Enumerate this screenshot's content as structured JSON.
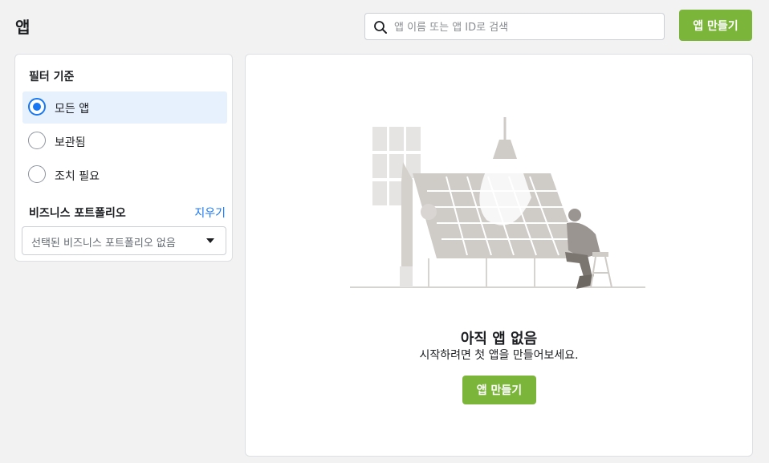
{
  "header": {
    "title": "앱",
    "search_placeholder": "앱 이름 또는 앱 ID로 검색",
    "search_icon": "search-icon",
    "create_button": "앱 만들기"
  },
  "sidebar": {
    "filter_heading": "필터 기준",
    "options": [
      {
        "label": "모든 앱",
        "selected": true
      },
      {
        "label": "보관됨",
        "selected": false
      },
      {
        "label": "조치 필요",
        "selected": false
      }
    ],
    "portfolio_heading": "비즈니스 포트폴리오",
    "clear_link": "지우기",
    "portfolio_select_value": "선택된 비즈니스 포트폴리오 없음",
    "select_icon": "caret-down-icon"
  },
  "main": {
    "illustration": "person-at-drafting-table-illustration",
    "empty_title": "아직 앱 없음",
    "empty_subtitle": "시작하려면 첫 앱을 만들어보세요.",
    "create_button": "앱 만들기"
  },
  "colors": {
    "accent_green": "#7bb53a",
    "selected_blue": "#1877f2",
    "selected_bg": "#e7f0fd",
    "link_blue": "#1877f2",
    "page_bg": "#f2f2f2"
  }
}
